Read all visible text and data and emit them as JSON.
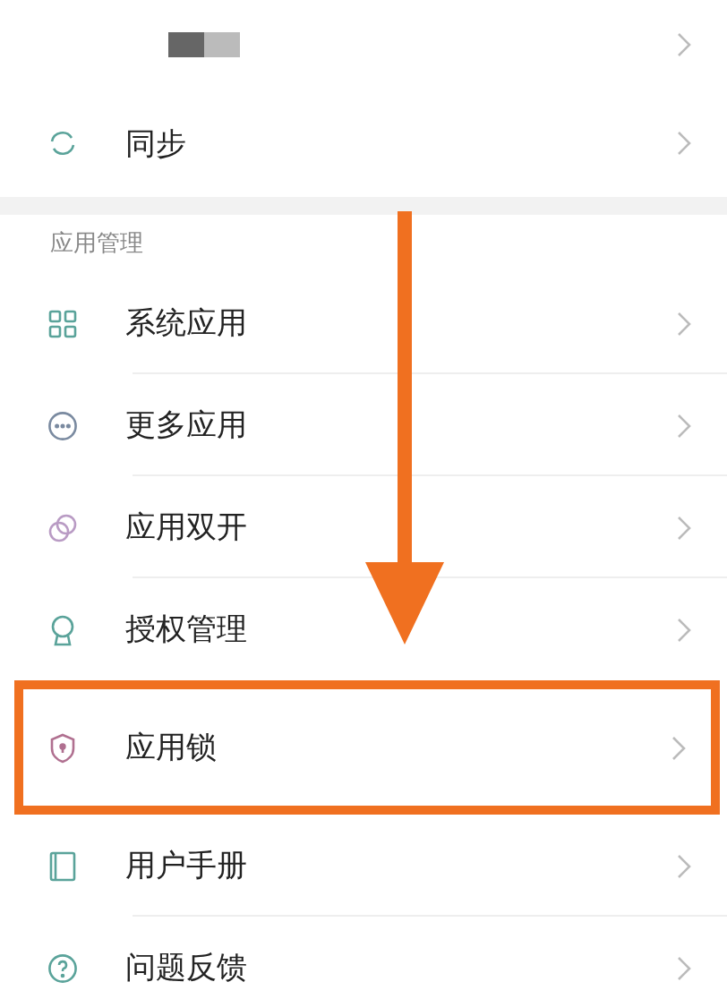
{
  "account_row": {
    "kind": "redacted"
  },
  "sync_row": {
    "label": "同步",
    "kind": "sync"
  },
  "section": {
    "title": "应用管理"
  },
  "items": [
    {
      "label": "系统应用",
      "kind": "grid",
      "highlighted": false
    },
    {
      "label": "更多应用",
      "kind": "more",
      "highlighted": false
    },
    {
      "label": "应用双开",
      "kind": "dual",
      "highlighted": false
    },
    {
      "label": "授权管理",
      "kind": "badge",
      "highlighted": false
    },
    {
      "label": "应用锁",
      "kind": "shield",
      "highlighted": true
    },
    {
      "label": "用户手册",
      "kind": "book",
      "highlighted": false
    },
    {
      "label": "问题反馈",
      "kind": "help",
      "highlighted": false
    }
  ],
  "annotation": {
    "kind": "down-arrow"
  }
}
